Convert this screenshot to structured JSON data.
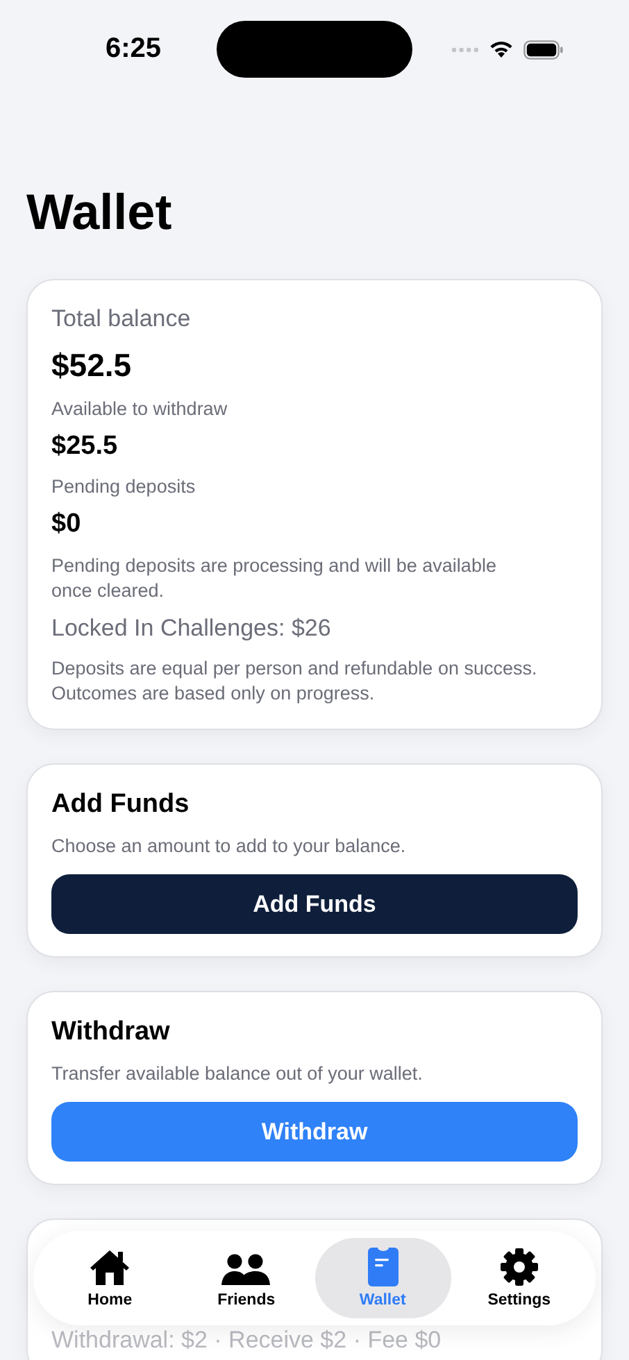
{
  "status_bar": {
    "time": "6:25"
  },
  "title": "Wallet",
  "balance_card": {
    "total_label": "Total balance",
    "total": "$52.5",
    "available_label": "Available to withdraw",
    "available": "$25.5",
    "pending_label": "Pending deposits",
    "pending": "$0",
    "pending_note": "Pending deposits are processing and will be available once cleared.",
    "locked": "Locked In Challenges: $26",
    "deposit_note": "Deposits are equal per person and refundable on success. Outcomes are based only on progress."
  },
  "actions": [
    {
      "kind": "add",
      "title": "Add Funds",
      "description": "Choose an amount to add to your balance.",
      "button": "Add Funds"
    },
    {
      "kind": "withdraw",
      "title": "Withdraw",
      "description": "Transfer available balance out of your wallet.",
      "button": "Withdraw"
    }
  ],
  "activity_card": {
    "line": "Withdrawal: $2 · Receive $2 · Fee $0"
  },
  "tab_bar": [
    {
      "kind": "home",
      "label": "Home",
      "selected": false
    },
    {
      "kind": "friends",
      "label": "Friends",
      "selected": false
    },
    {
      "kind": "wallet",
      "label": "Wallet",
      "selected": true
    },
    {
      "kind": "settings",
      "label": "Settings",
      "selected": false
    }
  ]
}
